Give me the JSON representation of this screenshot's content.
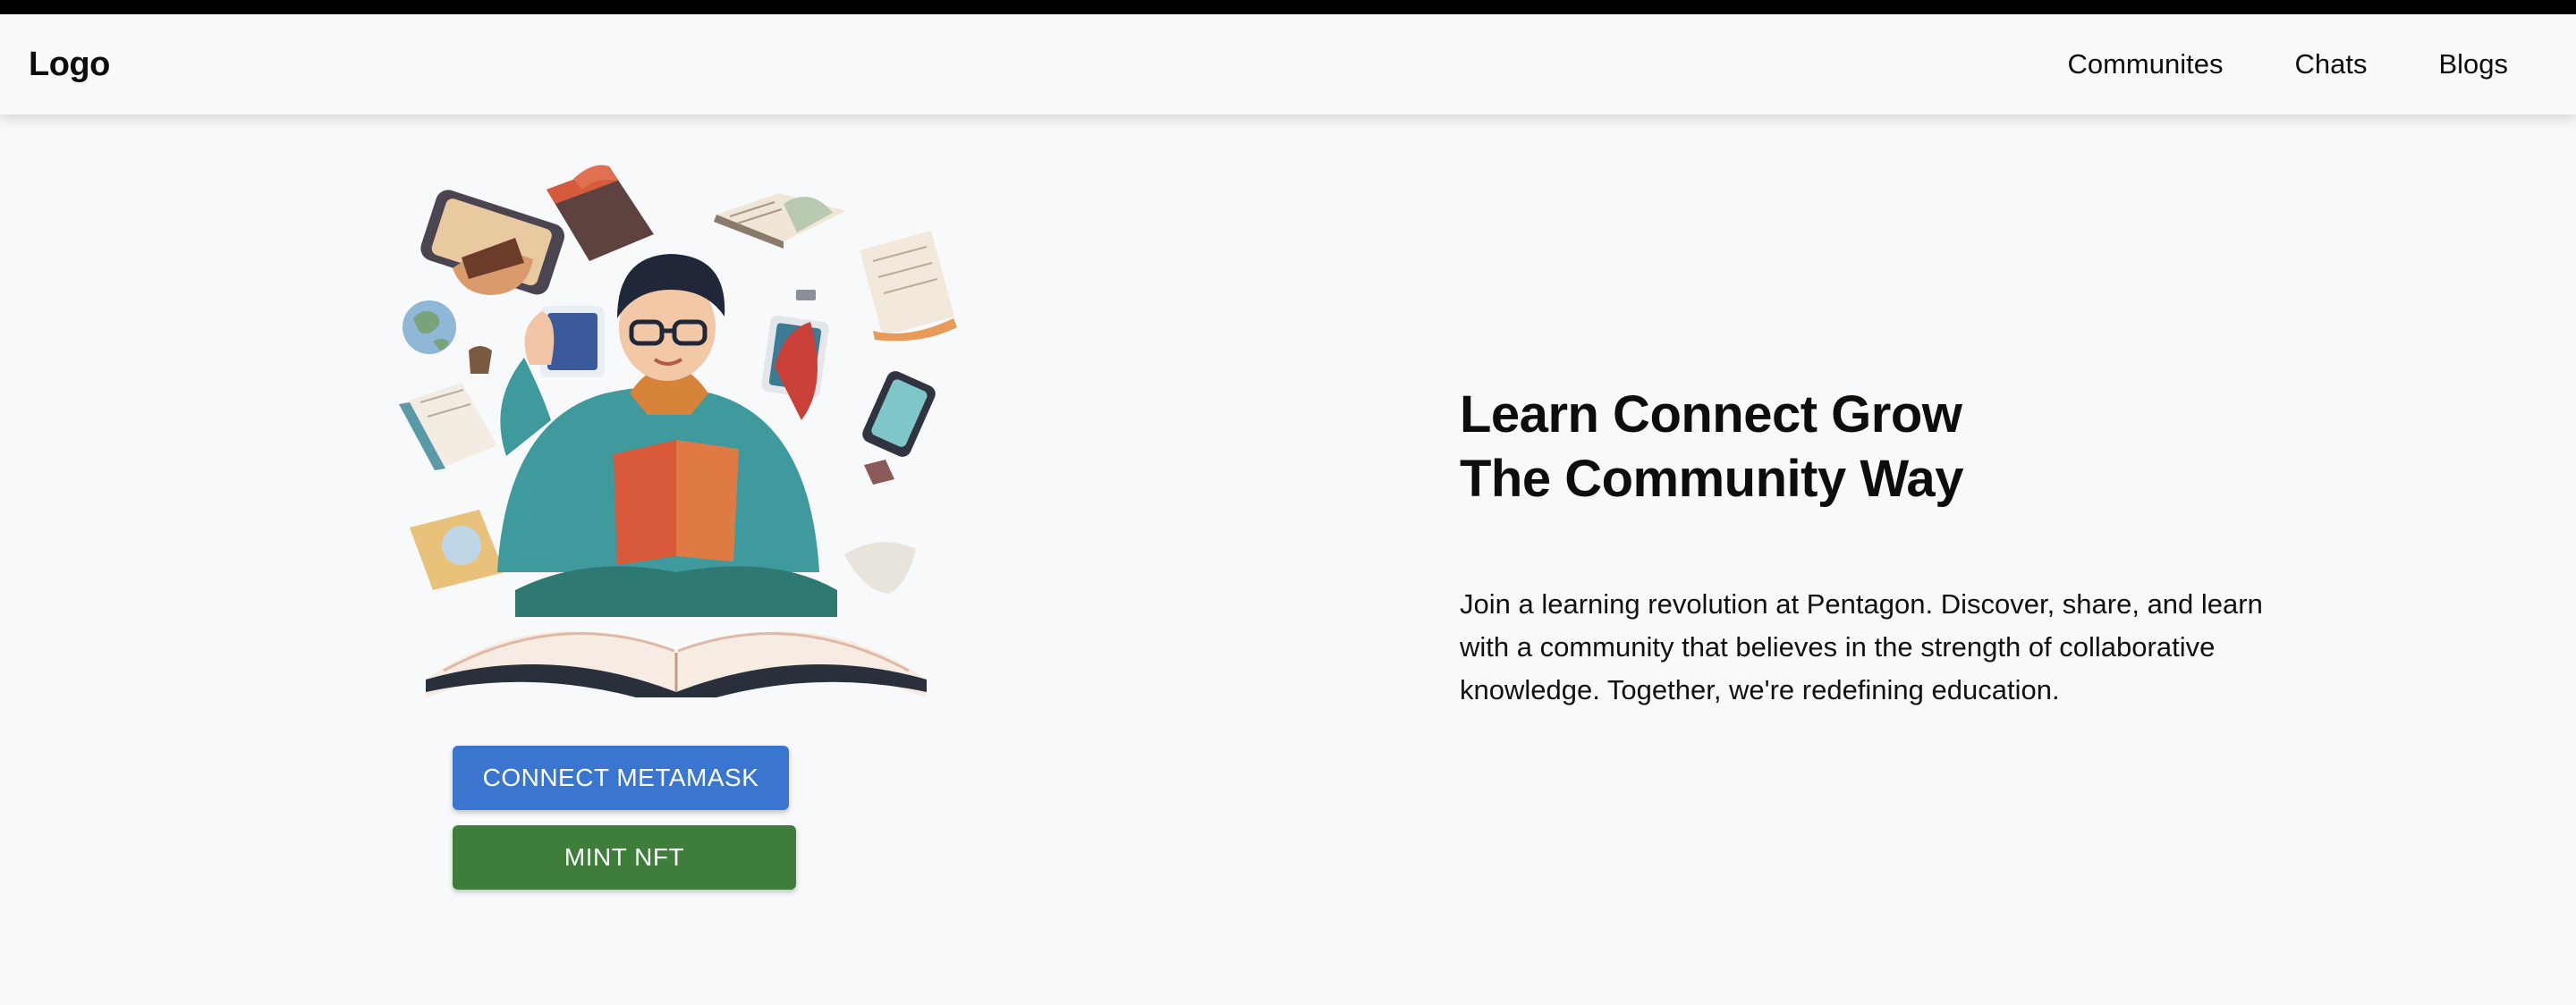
{
  "header": {
    "logo": "Logo",
    "nav": [
      {
        "label": "Communites"
      },
      {
        "label": "Chats"
      },
      {
        "label": "Blogs"
      }
    ]
  },
  "hero": {
    "illustration": "person-reading-surrounded-by-flying-books-and-devices",
    "headline_line1": "Learn Connect Grow",
    "headline_line2": "The Community Way",
    "description": "Join a learning revolution at Pentagon. Discover, share, and learn with a community that believes in the strength of collaborative knowledge. Together, we're redefining education."
  },
  "actions": {
    "connect_label": "CONNECT METAMASK",
    "mint_label": "MINT NFT"
  },
  "colors": {
    "connect_button": "#3a76d0",
    "mint_button": "#3f7d3b",
    "page_background": "#f8f9fb"
  }
}
